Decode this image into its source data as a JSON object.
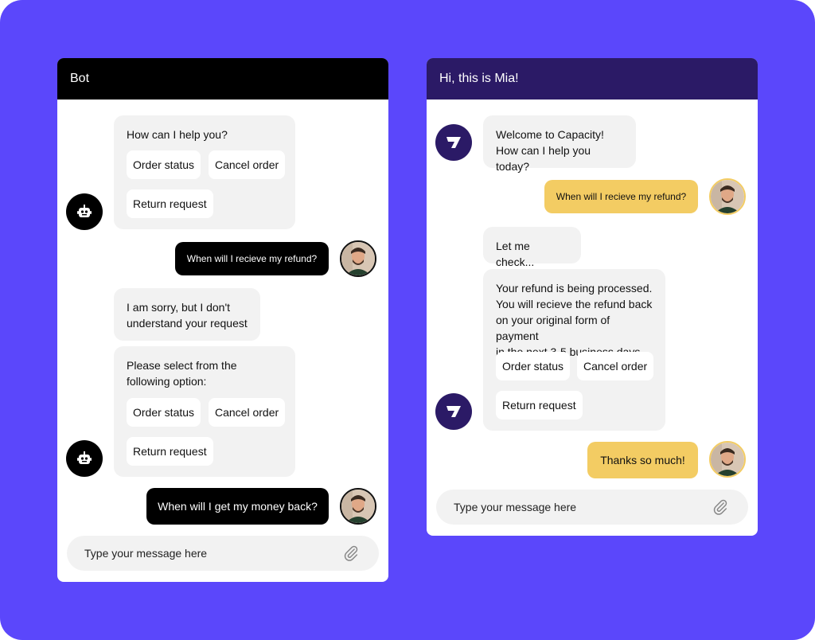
{
  "colors": {
    "background": "#5b47fb",
    "bot_header": "#000000",
    "mia_header": "#2b1a66",
    "bubble_gray": "#f2f2f2",
    "user_dark": "#000000",
    "user_yellow": "#f3cc63"
  },
  "left_panel": {
    "title": "Bot",
    "bot_message_1": "How can I help you?",
    "chips_1": [
      "Order status",
      "Cancel order",
      "Return request"
    ],
    "user_message_1": "When will I recieve my refund?",
    "bot_message_2": "I am sorry, but I don't\nunderstand your request",
    "bot_message_3": "Please select from the\nfollowing option:",
    "chips_2": [
      "Order status",
      "Cancel order",
      "Return request"
    ],
    "user_message_2": "When will I get my money back?",
    "input_placeholder": "Type your message here",
    "bot_icon": "robot-icon"
  },
  "right_panel": {
    "title": "Hi, this is Mia!",
    "bot_message_1": "Welcome to Capacity!\nHow can I help you today?",
    "user_message_1": "When will I recieve my refund?",
    "bot_message_2": "Let me check...",
    "bot_message_3": "Your refund is being processed.\nYou will recieve the refund back\non your original form of payment\nin the next 3-5 business days",
    "chips": [
      "Order status",
      "Cancel order",
      "Return request"
    ],
    "user_message_2": "Thanks so much!",
    "input_placeholder": "Type your message here",
    "bot_icon": "capacity-logo-icon"
  }
}
